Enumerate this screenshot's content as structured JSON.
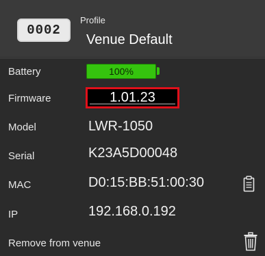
{
  "header": {
    "device_id": "0002",
    "profile_caption": "Profile",
    "profile_name": "Venue Default"
  },
  "battery": {
    "label": "Battery",
    "value": "100%",
    "level": 1.0
  },
  "firmware": {
    "label": "Firmware",
    "value": "1.01.23"
  },
  "model": {
    "label": "Model",
    "value": "LWR-1050"
  },
  "serial": {
    "label": "Serial",
    "value": "K23A5D00048"
  },
  "mac": {
    "label": "MAC",
    "value": "D0:15:BB:51:00:30"
  },
  "ip": {
    "label": "IP",
    "value": "192.168.0.192"
  },
  "actions": {
    "remove_label": "Remove from venue"
  },
  "icons": {
    "copy": "copy-icon",
    "trash": "trash-icon"
  },
  "colors": {
    "battery_green": "#35c40e",
    "highlight_red": "#e0101a"
  }
}
